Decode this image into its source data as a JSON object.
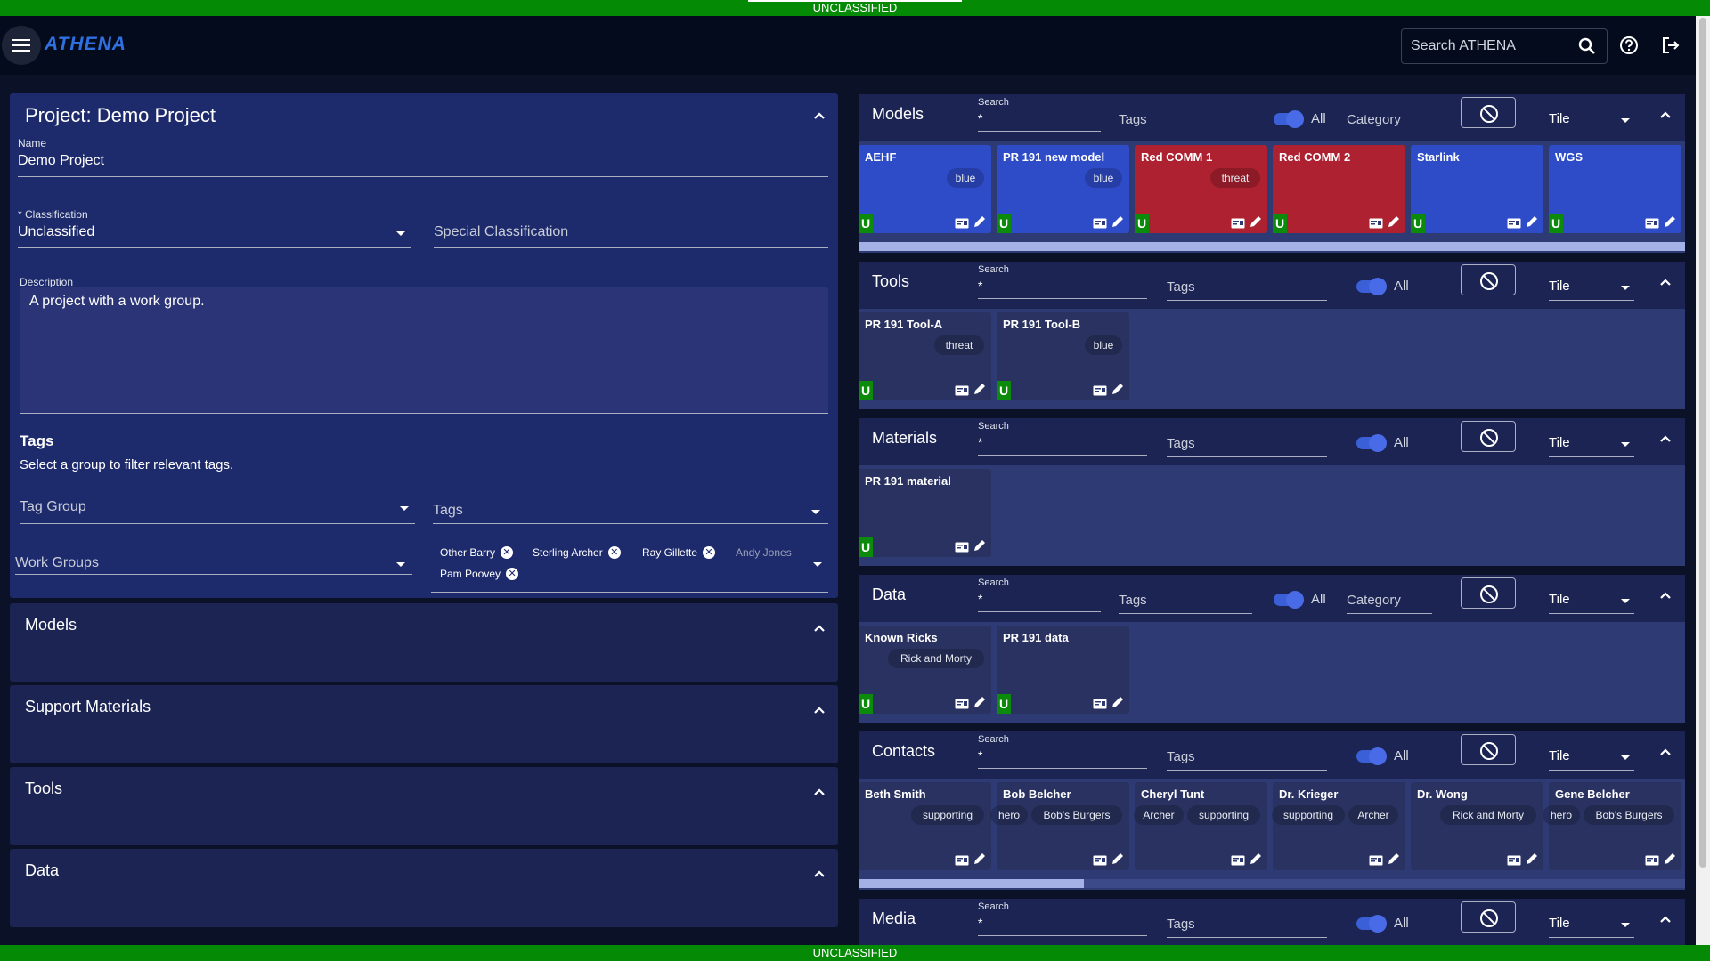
{
  "banner": "UNCLASSIFIED",
  "app": {
    "logo": "ATHENA",
    "search_placeholder": "Search ATHENA"
  },
  "project": {
    "title": "Project: Demo Project",
    "name_label": "Name",
    "name_value": "Demo Project",
    "classification_label": "* Classification",
    "classification_value": "Unclassified",
    "special_classification_placeholder": "Special Classification",
    "description_label": "Description",
    "description_value": "A project with a work group.",
    "tags_heading": "Tags",
    "tags_hint": "Select a group to filter relevant tags.",
    "tag_group_placeholder": "Tag Group",
    "tags_placeholder": "Tags",
    "work_groups_placeholder": "Work Groups",
    "members": [
      "Other Barry",
      "Sterling Archer",
      "Ray Gillette",
      "Pam Poovey"
    ],
    "members_remaining": "Andy Jones",
    "subsections": [
      "Models",
      "Support Materials",
      "Tools",
      "Data"
    ]
  },
  "sections": [
    {
      "title": "Models",
      "search_label": "Search",
      "search_value": "*",
      "tags_placeholder": "Tags",
      "toggle_label": "All",
      "category_placeholder": "Category",
      "view": "Tile",
      "tiles": [
        {
          "name": "AEHF",
          "tags": [
            "blue"
          ],
          "color": "blue",
          "badge": "U"
        },
        {
          "name": "PR 191 new model",
          "tags": [
            "blue"
          ],
          "color": "blue",
          "badge": "U"
        },
        {
          "name": "Red COMM 1",
          "tags": [
            "threat"
          ],
          "color": "red",
          "badge": "U"
        },
        {
          "name": "Red COMM 2",
          "tags": [],
          "color": "red",
          "badge": "U"
        },
        {
          "name": "Starlink",
          "tags": [],
          "color": "blue",
          "badge": "U"
        },
        {
          "name": "WGS",
          "tags": [],
          "color": "blue",
          "badge": "U"
        }
      ]
    },
    {
      "title": "Tools",
      "search_label": "Search",
      "search_value": "*",
      "tags_placeholder": "Tags",
      "toggle_label": "All",
      "view": "Tile",
      "tiles": [
        {
          "name": "PR 191 Tool-A",
          "tags": [
            "threat"
          ],
          "badge": "U"
        },
        {
          "name": "PR 191 Tool-B",
          "tags": [
            "blue"
          ],
          "badge": "U"
        }
      ]
    },
    {
      "title": "Materials",
      "search_label": "Search",
      "search_value": "*",
      "tags_placeholder": "Tags",
      "toggle_label": "All",
      "view": "Tile",
      "tiles": [
        {
          "name": "PR 191 material",
          "tags": [],
          "badge": "U"
        }
      ]
    },
    {
      "title": "Data",
      "search_label": "Search",
      "search_value": "*",
      "tags_placeholder": "Tags",
      "toggle_label": "All",
      "category_placeholder": "Category",
      "view": "Tile",
      "tiles": [
        {
          "name": "Known Ricks",
          "tags": [
            "Rick and Morty"
          ],
          "badge": "U"
        },
        {
          "name": "PR 191 data",
          "tags": [],
          "badge": "U"
        }
      ]
    },
    {
      "title": "Contacts",
      "search_label": "Search",
      "search_value": "*",
      "tags_placeholder": "Tags",
      "toggle_label": "All",
      "view": "Tile",
      "tiles": [
        {
          "name": "Beth Smith",
          "tags": [
            "supporting"
          ]
        },
        {
          "name": "Bob Belcher",
          "tags": [
            "hero",
            "Bob's Burgers"
          ]
        },
        {
          "name": "Cheryl Tunt",
          "tags": [
            "Archer",
            "supporting"
          ]
        },
        {
          "name": "Dr. Krieger",
          "tags": [
            "supporting",
            "Archer"
          ]
        },
        {
          "name": "Dr. Wong",
          "tags": [
            "Rick and Morty"
          ]
        },
        {
          "name": "Gene Belcher",
          "tags": [
            "hero",
            "Bob's Burgers"
          ]
        }
      ]
    },
    {
      "title": "Media",
      "search_label": "Search",
      "search_value": "*",
      "tags_placeholder": "Tags",
      "toggle_label": "All",
      "view": "Tile",
      "tiles": []
    }
  ],
  "colors": {
    "accent": "#2f6fe0",
    "banner": "#058a05",
    "tile_blue": "#2e4bc8",
    "tile_red": "#ad2130"
  }
}
